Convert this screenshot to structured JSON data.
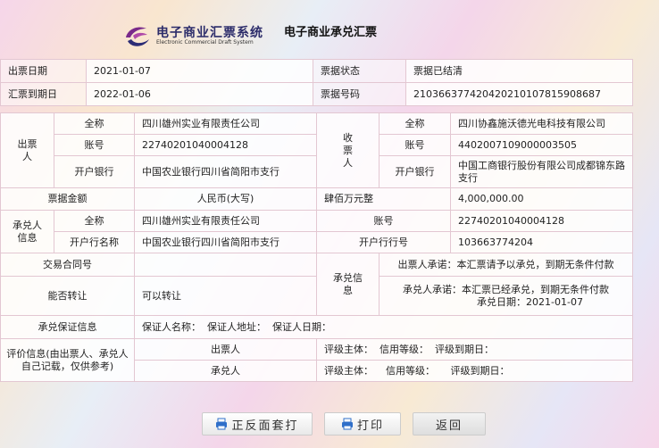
{
  "header": {
    "logo_cn": "电子商业汇票系统",
    "logo_en": "Electronic Commercial Draft System",
    "title": "电子商业承兑汇票"
  },
  "summary": {
    "issue_date_label": "出票日期",
    "issue_date": "2021-01-07",
    "status_label": "票据状态",
    "status": "票据已结清",
    "due_date_label": "汇票到期日",
    "due_date": "2022-01-06",
    "bill_no_label": "票据号码",
    "bill_no": "210366377420420210107815908687"
  },
  "drawer": {
    "label": "出票人",
    "name_label": "全称",
    "name": "四川雄州实业有限责任公司",
    "account_label": "账号",
    "account": "22740201040004128",
    "bank_label": "开户银行",
    "bank": "中国农业银行四川省简阳市支行"
  },
  "payee": {
    "label": "收票人",
    "name_label": "全称",
    "name": "四川协鑫施沃德光电科技有限公司",
    "account_label": "账号",
    "account": "4402007109000003505",
    "bank_label": "开户银行",
    "bank": "中国工商银行股份有限公司成都锦东路支行"
  },
  "amount": {
    "label": "票据金额",
    "upper_label": "人民币(大写)",
    "upper": "肆佰万元整",
    "value": "4,000,000.00"
  },
  "acceptor": {
    "label": "承兑人信息",
    "name_label": "全称",
    "name": "四川雄州实业有限责任公司",
    "account_label": "账号",
    "account": "22740201040004128",
    "bank_name_label": "开户行名称",
    "bank_name": "中国农业银行四川省简阳市支行",
    "bank_no_label": "开户行行号",
    "bank_no": "103663774204"
  },
  "contract": {
    "label": "交易合同号",
    "value": ""
  },
  "transfer": {
    "label": "能否转让",
    "value": "可以转让"
  },
  "acceptance": {
    "label": "承兑信息",
    "drawer_promise": "出票人承诺：本汇票请予以承兑，到期无条件付款",
    "acceptor_promise": "承兑人承诺：本汇票已经承兑，到期无条件付款",
    "accept_date": "承兑日期：2021-01-07"
  },
  "guarantee": {
    "label": "承兑保证信息",
    "value": "保证人名称：  保证人地址：  保证人日期："
  },
  "rating": {
    "label": "评价信息(由出票人、承兑人自己记载，仅供参考)",
    "drawer_label": "出票人",
    "drawer_value": "评级主体：  信用等级：  评级到期日：",
    "acceptor_label": "承兑人",
    "acceptor_value": "评级主体：    信用等级：     评级到期日："
  },
  "buttons": {
    "print_both": "正反面套打",
    "print": "打印",
    "back": "返回"
  },
  "colors": {
    "border": "#e3c7d2",
    "logo_purple": "#7a2a8a",
    "icon_blue": "#2f6fc9"
  }
}
